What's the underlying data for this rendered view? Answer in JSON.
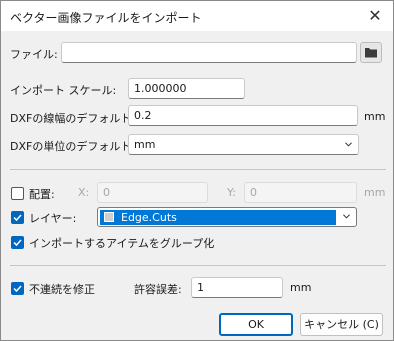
{
  "window": {
    "title": "ベクター画像ファイルをインポート"
  },
  "file": {
    "label": "ファイル:",
    "value": ""
  },
  "scale": {
    "label": "インポート スケール:",
    "value": "1.000000"
  },
  "line_width": {
    "label": "DXFの線幅のデフォルト:",
    "value": "0.2",
    "unit": "mm"
  },
  "unit_default": {
    "label": "DXFの単位のデフォルト:",
    "value": "mm"
  },
  "placement": {
    "label": "配置:",
    "checked": false,
    "x_label": "X:",
    "x_value": "0",
    "y_label": "Y:",
    "y_value": "0",
    "unit": "mm"
  },
  "layer": {
    "label": "レイヤー:",
    "checked": true,
    "value": "Edge.Cuts"
  },
  "group": {
    "label": "インポートするアイテムをグループ化",
    "checked": true
  },
  "fix_discontinuity": {
    "label": "不連続を修正",
    "checked": true,
    "tolerance_label": "許容誤差:",
    "tolerance_value": "1",
    "unit": "mm"
  },
  "buttons": {
    "ok": "OK",
    "cancel": "キャンセル (C)"
  },
  "colors": {
    "accent": "#0067c0",
    "selection": "#0078d7"
  }
}
